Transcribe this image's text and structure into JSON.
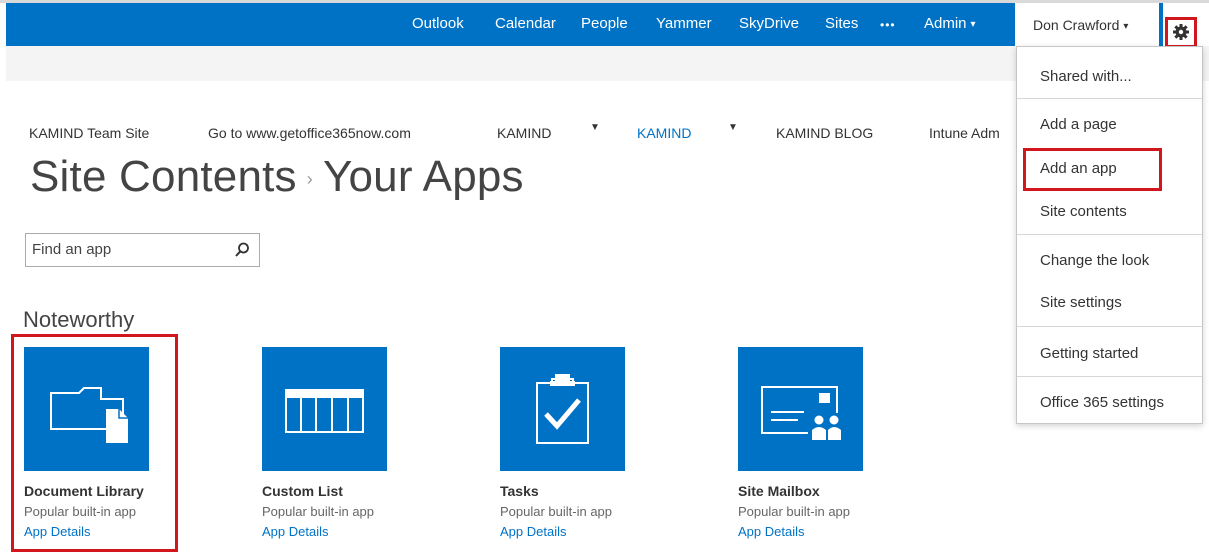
{
  "suite_bar": {
    "links": [
      "Outlook",
      "Calendar",
      "People",
      "Yammer",
      "SkyDrive",
      "Sites",
      "•••",
      "Admin"
    ],
    "admin_caret": "▾",
    "user_name": "Don Crawford",
    "bar_color": "#0072c6"
  },
  "top_nav": {
    "items": [
      "KAMIND Team Site",
      "Go to www.getoffice365now.com",
      "KAMIND",
      "KAMIND",
      "KAMIND BLOG",
      "Intune Adm"
    ],
    "active_index": 3
  },
  "page": {
    "title_part1": "Site Contents",
    "separator": "›",
    "title_part2": "Your Apps"
  },
  "search": {
    "placeholder": "Find an app",
    "value": ""
  },
  "section": {
    "heading": "Noteworthy"
  },
  "apps": [
    {
      "name": "Document Library",
      "subtitle": "Popular built-in app",
      "link": "App Details",
      "icon": "document-library-icon"
    },
    {
      "name": "Custom List",
      "subtitle": "Popular built-in app",
      "link": "App Details",
      "icon": "custom-list-icon"
    },
    {
      "name": "Tasks",
      "subtitle": "Popular built-in app",
      "link": "App Details",
      "icon": "tasks-icon"
    },
    {
      "name": "Site Mailbox",
      "subtitle": "Popular built-in app",
      "link": "App Details",
      "icon": "site-mailbox-icon"
    }
  ],
  "settings_menu": {
    "items": [
      "Shared with...",
      "Add a page",
      "Add an app",
      "Site contents",
      "Change the look",
      "Site settings",
      "Getting started",
      "Office 365 settings"
    ]
  },
  "colors": {
    "accent": "#0072c6",
    "highlight": "#d2161e"
  }
}
